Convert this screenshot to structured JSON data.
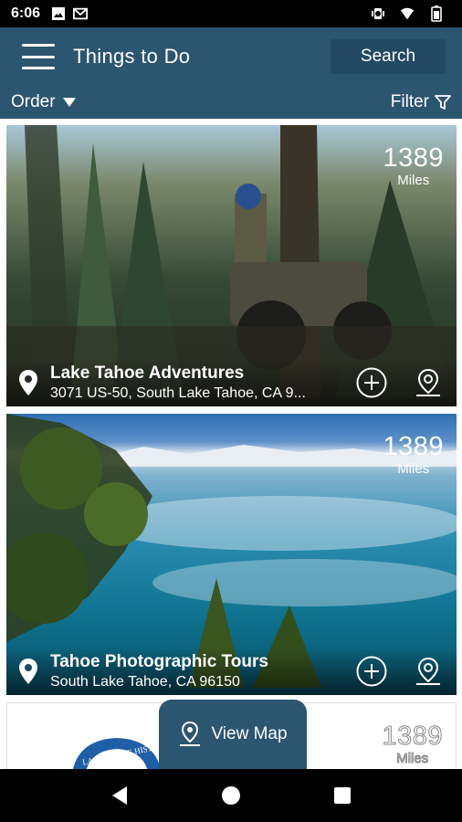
{
  "status_bar": {
    "time": "6:06",
    "icons": [
      "image-icon",
      "gmail-icon",
      "vibrate-icon",
      "wifi-icon",
      "battery-icon"
    ]
  },
  "app_bar": {
    "title": "Things to Do",
    "search_label": "Search"
  },
  "toolbar": {
    "order_label": "Order",
    "filter_label": "Filter"
  },
  "listings": [
    {
      "name": "Lake Tahoe Adventures",
      "address": "3071 US-50, South Lake Tahoe, CA 9...",
      "distance": "1389",
      "distance_unit": "Miles"
    },
    {
      "name": "Tahoe Photographic Tours",
      "address": "South Lake Tahoe, CA 96150",
      "distance": "1389",
      "distance_unit": "Miles"
    },
    {
      "logo_text": "LAKE TAHOE HISTO...",
      "distance": "1389",
      "distance_unit": "Miles"
    }
  ],
  "view_map_label": "View Map",
  "colors": {
    "primary": "#2c5570",
    "primary_dark": "#234862",
    "status_bar": "#000000"
  }
}
